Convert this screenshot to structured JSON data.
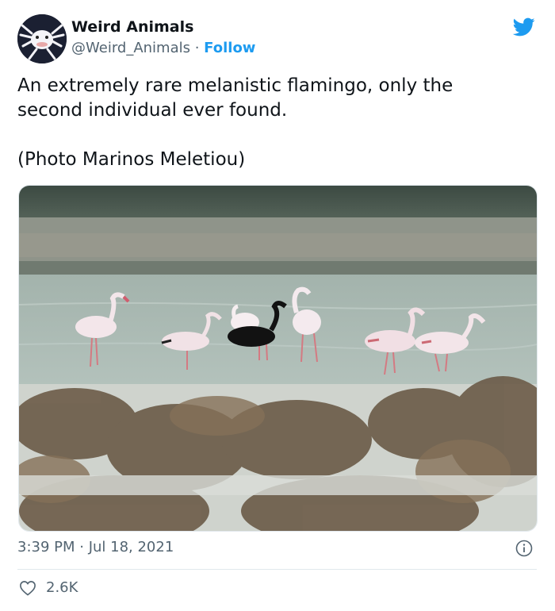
{
  "account": {
    "display_name": "Weird Animals",
    "handle": "@Weird_Animals",
    "separator": " · ",
    "follow_label": "Follow"
  },
  "tweet": {
    "text": "An extremely rare melanistic flamingo, only the\nsecond individual ever found.\n\n(Photo Marinos Meletiou)",
    "timestamp": "3:39 PM · Jul 18, 2021",
    "likes": "2.6K"
  },
  "icons": {
    "brand": "twitter-bird-icon",
    "info": "info-icon",
    "like": "heart-icon"
  },
  "colors": {
    "brand_blue": "#1d9bf0",
    "secondary_text": "#536471",
    "primary_text": "#0f1419"
  }
}
